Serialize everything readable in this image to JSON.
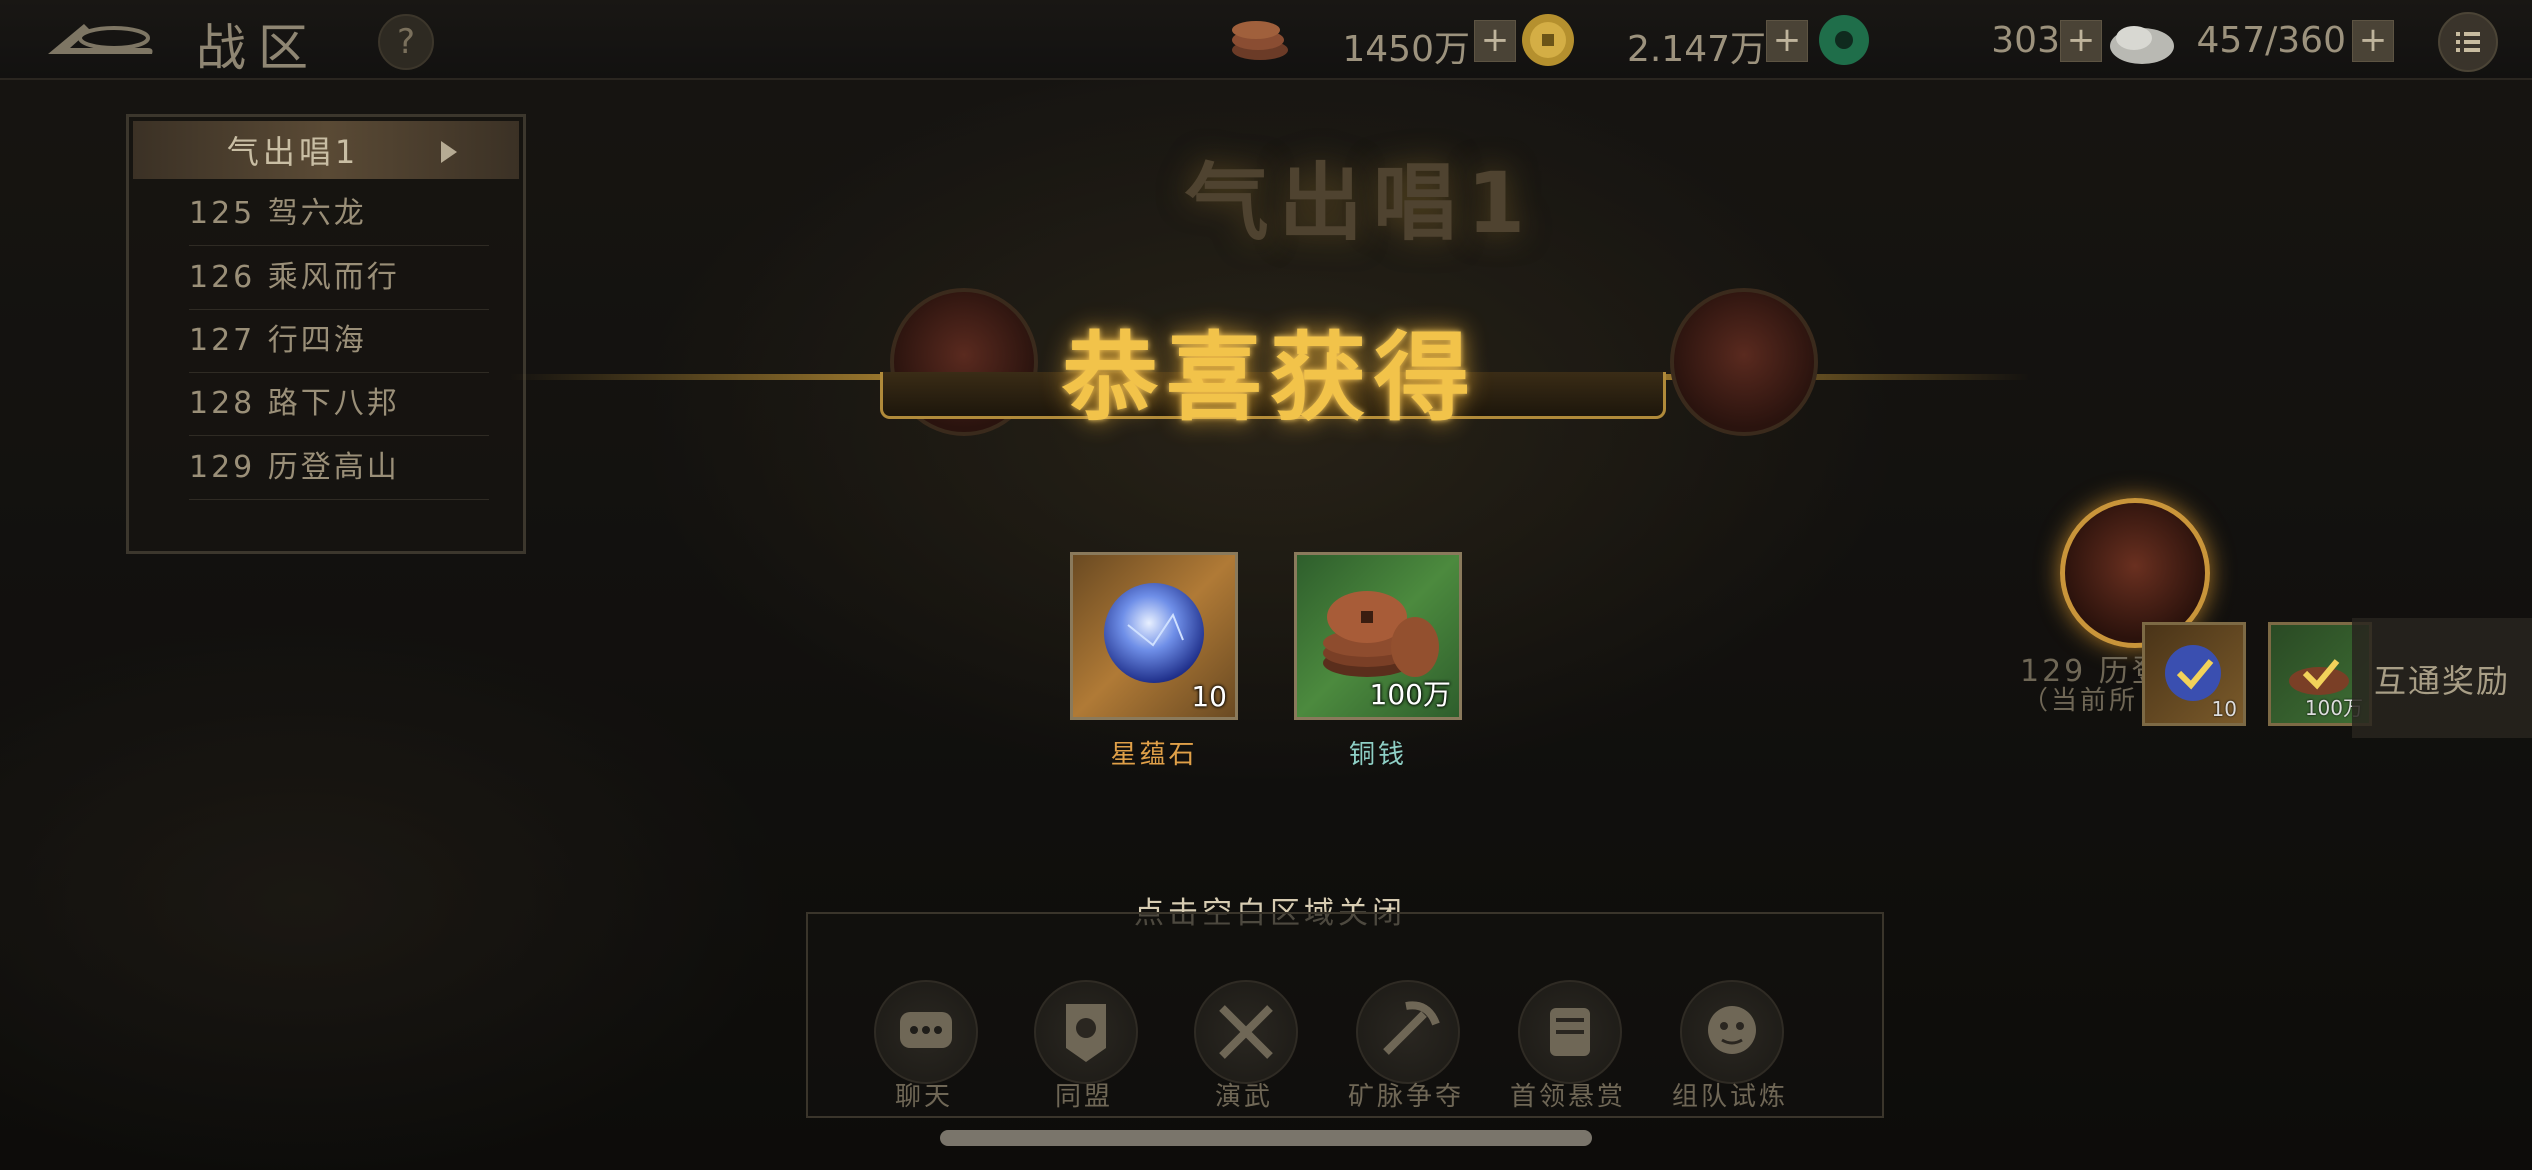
{
  "topbar": {
    "title": "战区",
    "help": "?",
    "resources": [
      {
        "icon": "copper-coin-stack-icon",
        "value": "1450万"
      },
      {
        "icon": "gold-coin-icon",
        "value": "2.147万"
      },
      {
        "icon": "jade-disc-icon",
        "value": "303"
      },
      {
        "icon": "stamina-stone-icon",
        "value": "457/360"
      }
    ],
    "plus": "+"
  },
  "zone_list": {
    "header": "气出唱1",
    "items": [
      "125 驾六龙",
      "126 乘风而行",
      "127 行四海",
      "128 路下八邦",
      "129 历登高山"
    ]
  },
  "zone_big_title": "气出唱1",
  "popup": {
    "title": "恭喜获得",
    "rewards": [
      {
        "name": "星蕴石",
        "qty": "10",
        "name_color": "#e0a048"
      },
      {
        "name": "铜钱",
        "qty": "100万",
        "name_color": "#8fd0c6"
      }
    ],
    "close_hint": "点击空白区域关闭"
  },
  "side": {
    "zone_text": "129 历登",
    "sub_text": "（当前所",
    "mini_items": [
      {
        "qty": "10"
      },
      {
        "qty": "100万"
      }
    ],
    "interop_label": "互通奖励"
  },
  "bottom_nav": [
    {
      "label": "聊天",
      "icon": "chat-bubble-icon"
    },
    {
      "label": "同盟",
      "icon": "alliance-banner-icon"
    },
    {
      "label": "演武",
      "icon": "crossed-swords-icon"
    },
    {
      "label": "矿脉争夺",
      "icon": "pickaxe-icon"
    },
    {
      "label": "首领悬赏",
      "icon": "scroll-icon"
    },
    {
      "label": "组队试炼",
      "icon": "team-mask-icon"
    }
  ],
  "colors": {
    "gold": "#f2c34a",
    "accent_brown": "#5a4a35"
  }
}
